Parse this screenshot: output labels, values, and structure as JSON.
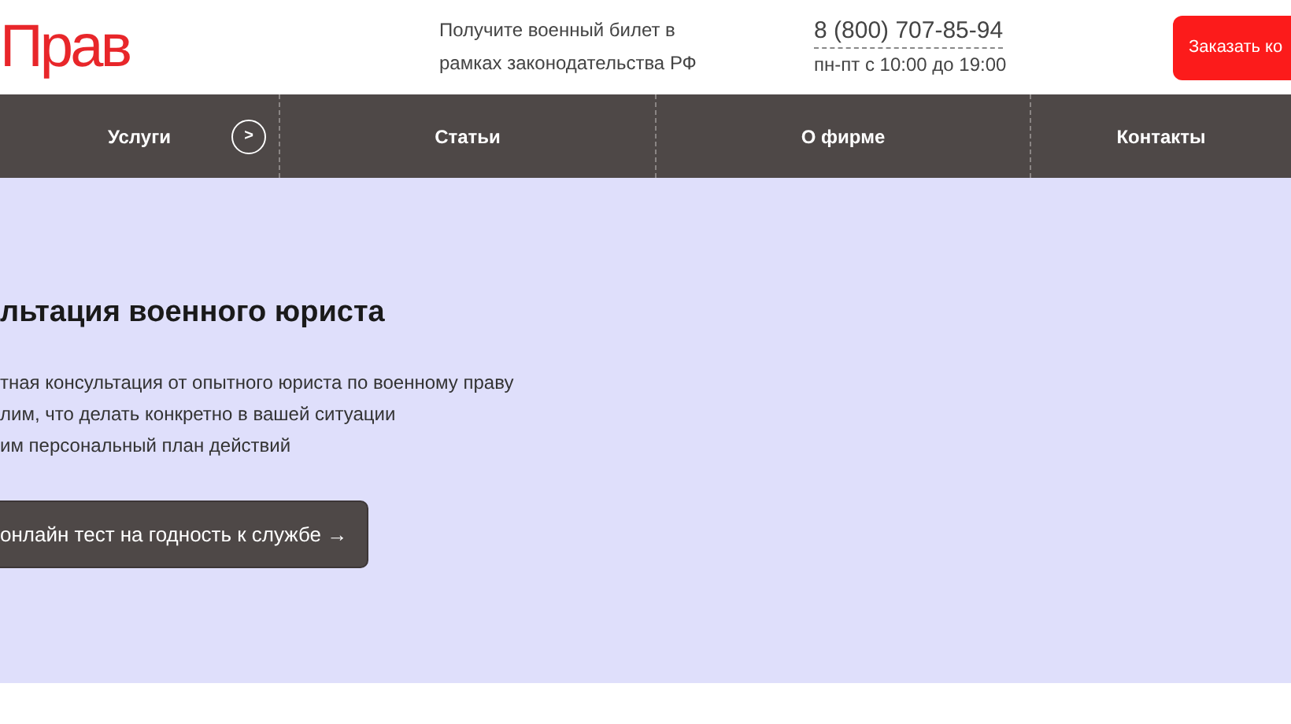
{
  "header": {
    "logo": "Прав",
    "tagline": [
      "Получите военный билет в",
      "рамках законодательства РФ"
    ],
    "phone": "8 (800) 707-85-94",
    "hours": "пн-пт с 10:00 до 19:00",
    "cta_button": "Заказать ко"
  },
  "nav": [
    {
      "label": "Услуги",
      "arrow": ">"
    },
    {
      "label": "Статьи"
    },
    {
      "label": "О фирме"
    },
    {
      "label": "Контакты"
    }
  ],
  "hero": {
    "title": "льтация военного юриста",
    "bullets": [
      "тная консультация от опытного юриста по военному праву",
      "лим, что делать конкретно в вашей ситуации",
      "им персональный план действий"
    ],
    "button": "онлайн тест на годность к службе →"
  }
}
